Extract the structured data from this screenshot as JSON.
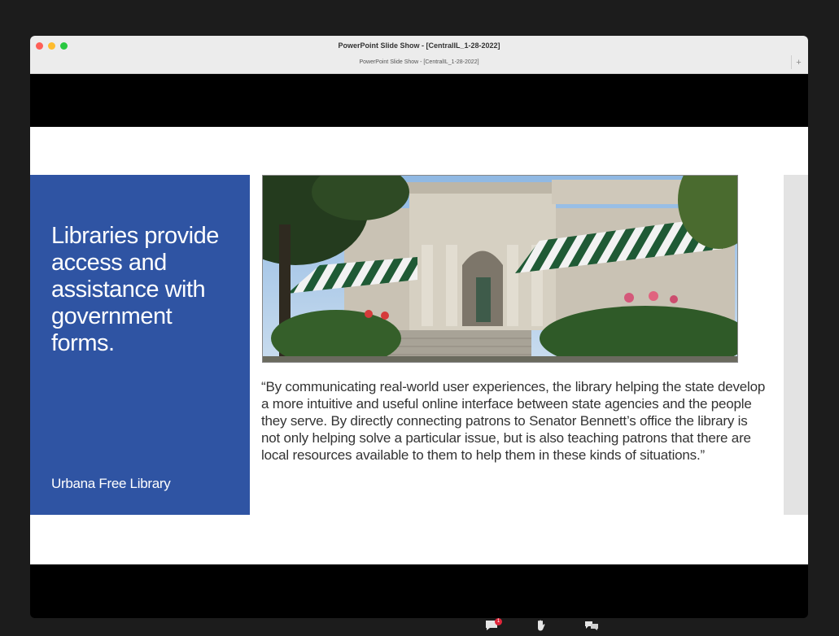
{
  "window": {
    "title": "PowerPoint Slide Show - [CentralIL_1-28-2022]",
    "tab_title": "PowerPoint Slide Show - [CentralIL_1-28-2022]",
    "new_tab_label": "+"
  },
  "slide": {
    "heading": "Libraries provide access and assistance with government forms.",
    "footer": "Urbana Free Library",
    "quote": "“By communicating real-world user experiences, the library helping the state develop a more intuitive and useful online interface between state agencies and the people they serve. By directly connecting patrons to Senator Bennett’s office the library is not only helping solve a particular issue, but is also teaching patrons that there are local resources available to them to help them in these kinds of situations.”"
  },
  "toolbar": {
    "chat_badge": "1",
    "chat_icon": "chat-icon",
    "reactions_icon": "raise-hand-icon",
    "more_icon": "reactions-icon"
  },
  "colors": {
    "panel_blue": "#2f54a3",
    "awning_green": "#1f5a35"
  }
}
